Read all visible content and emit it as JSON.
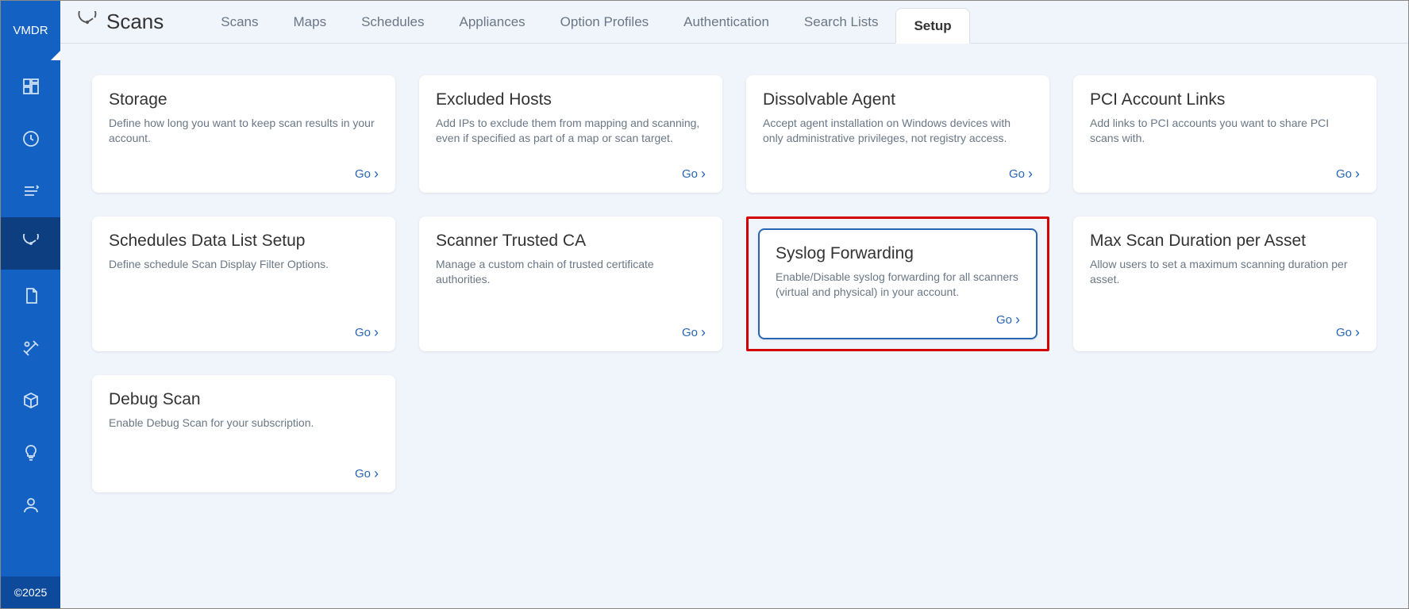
{
  "app_label": "VMDR",
  "footer": "©2025",
  "section_title": "Scans",
  "tabs": [
    {
      "label": "Scans",
      "active": false
    },
    {
      "label": "Maps",
      "active": false
    },
    {
      "label": "Schedules",
      "active": false
    },
    {
      "label": "Appliances",
      "active": false
    },
    {
      "label": "Option Profiles",
      "active": false
    },
    {
      "label": "Authentication",
      "active": false
    },
    {
      "label": "Search Lists",
      "active": false
    },
    {
      "label": "Setup",
      "active": true
    }
  ],
  "go_label": "Go",
  "cards": [
    {
      "title": "Storage",
      "desc": "Define how long you want to keep scan results in your account."
    },
    {
      "title": "Excluded Hosts",
      "desc": "Add IPs to exclude them from mapping and scanning, even if specified as part of a map or scan target."
    },
    {
      "title": "Dissolvable Agent",
      "desc": "Accept agent installation on Windows devices with only administrative privileges, not registry access."
    },
    {
      "title": "PCI Account Links",
      "desc": "Add links to PCI accounts you want to share PCI scans with."
    },
    {
      "title": "Schedules Data List Setup",
      "desc": "Define schedule Scan Display Filter Options."
    },
    {
      "title": "Scanner Trusted CA",
      "desc": "Manage a custom chain of trusted certificate authorities."
    },
    {
      "title": "Syslog Forwarding",
      "desc": "Enable/Disable syslog forwarding for all scanners (virtual and physical) in your account.",
      "highlighted": true
    },
    {
      "title": "Max Scan Duration per Asset",
      "desc": "Allow users to set a maximum scanning duration per asset."
    },
    {
      "title": "Debug Scan",
      "desc": "Enable Debug Scan for your subscription."
    }
  ],
  "sidebar_icons": [
    "dashboard",
    "activity",
    "prioritize",
    "scans",
    "reports",
    "tools",
    "cube",
    "bulb",
    "user"
  ]
}
